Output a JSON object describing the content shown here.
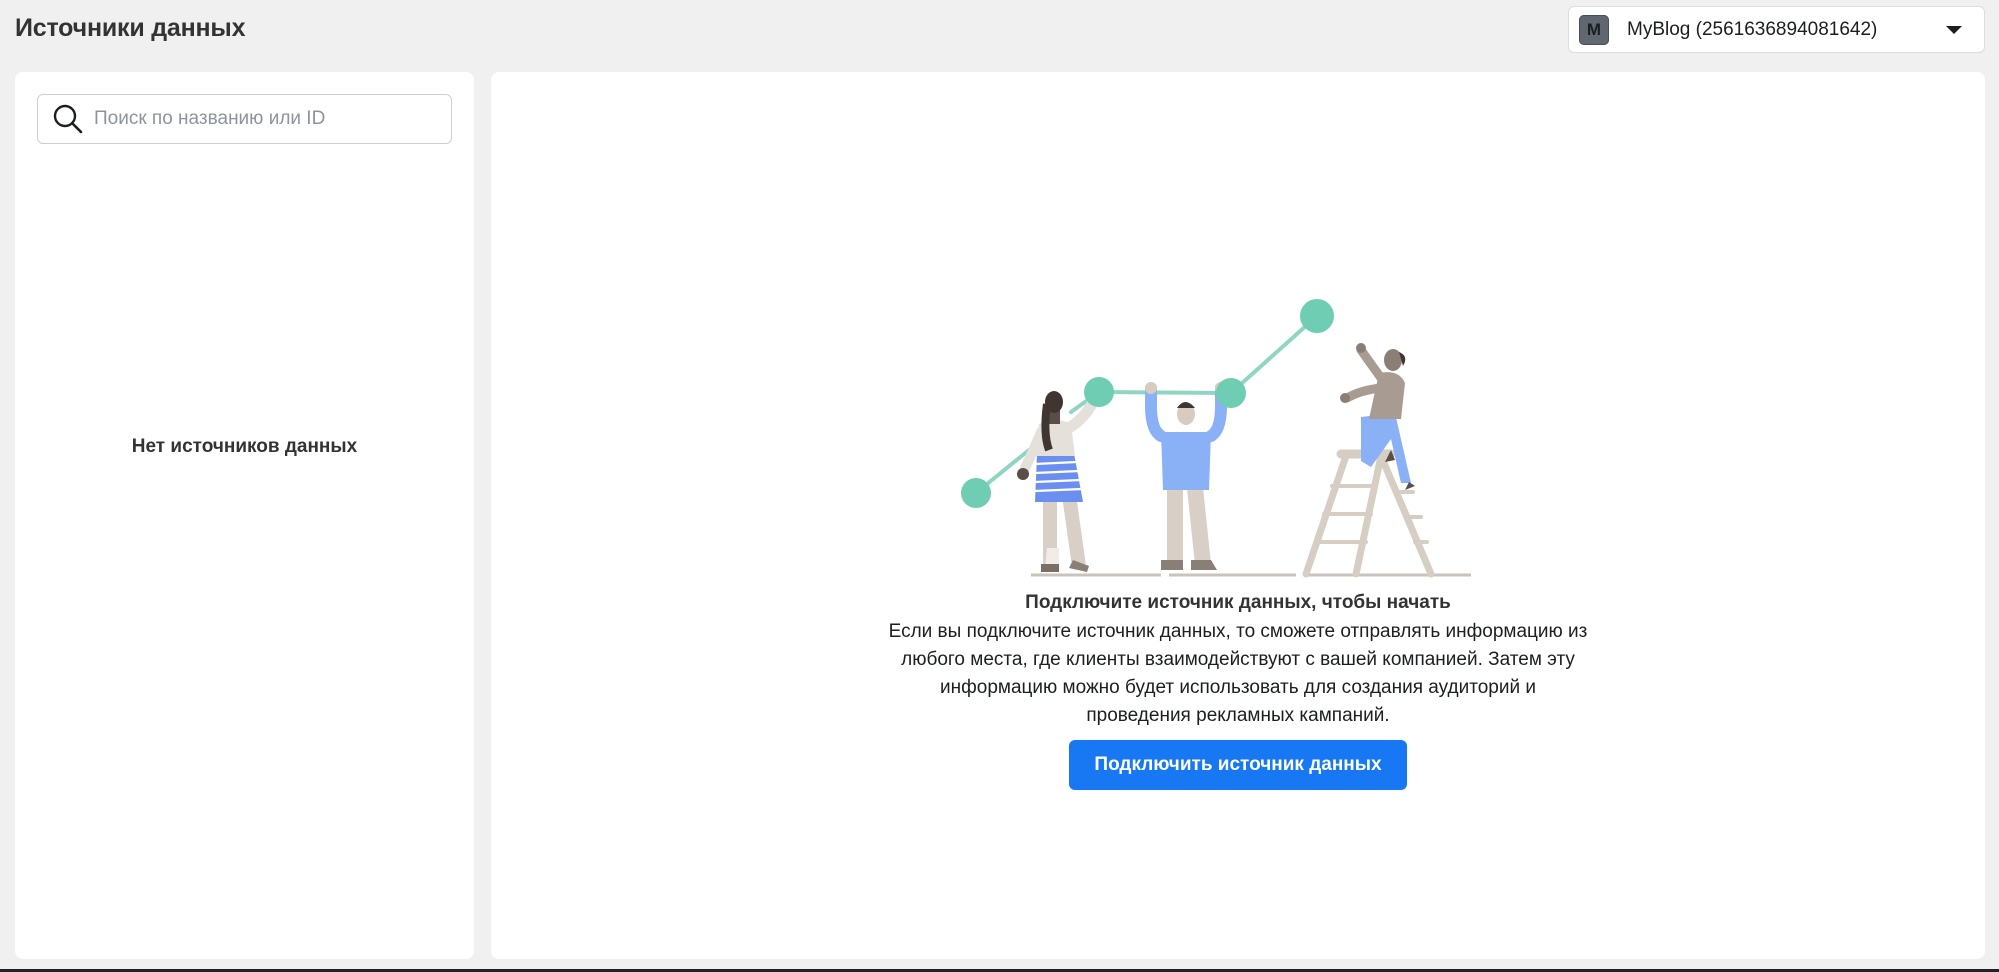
{
  "header": {
    "title": "Источники данных"
  },
  "account_selector": {
    "avatar_letter": "M",
    "name": "MyBlog (2561636894081642)"
  },
  "sidebar": {
    "search_placeholder": "Поиск по названию или ID",
    "search_value": "",
    "empty_state": "Нет источников данных"
  },
  "main": {
    "title": "Подключите источник данных, чтобы начать",
    "description": "Если вы подключите источник данных, то сможете отправлять информацию из любого места, где клиенты взаимодействуют с вашей компанией. Затем эту информацию можно будет использовать для создания аудиторий и проведения рекламных кампаний.",
    "button_label": "Подключить источник данных"
  },
  "colors": {
    "primary_button": "#1877f2",
    "accent_teal": "#6ecdb3",
    "figure_blue": "#8ab0f5",
    "figure_beige": "#d8d0c6"
  }
}
